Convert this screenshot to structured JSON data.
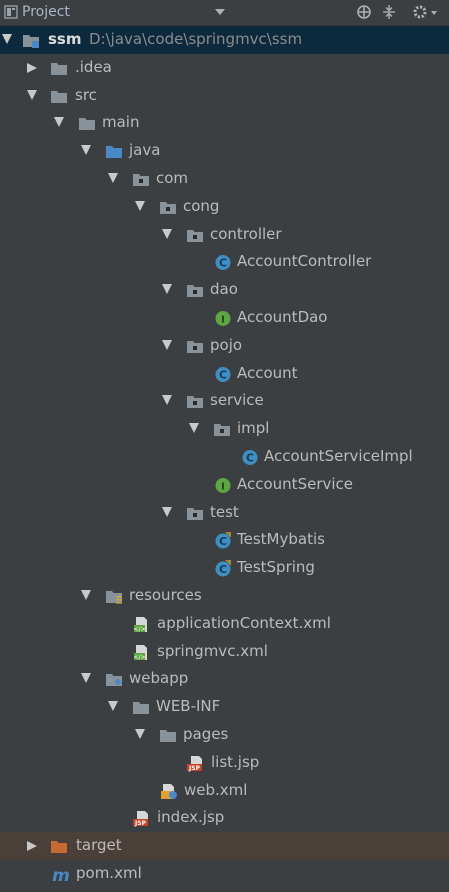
{
  "header": {
    "title": "Project"
  },
  "tree": [
    {
      "id": "ssm",
      "label": "ssm",
      "path": "D:\\java\\code\\springmvc\\ssm",
      "arrow": "down",
      "icon": "module-folder-icon",
      "bold": true,
      "selected": true
    },
    {
      "id": "idea",
      "label": ".idea",
      "arrow": "right",
      "icon": "folder-icon"
    },
    {
      "id": "src",
      "label": "src",
      "arrow": "down",
      "icon": "folder-icon"
    },
    {
      "id": "main",
      "label": "main",
      "arrow": "down",
      "icon": "folder-icon"
    },
    {
      "id": "java",
      "label": "java",
      "arrow": "down",
      "icon": "source-folder-icon"
    },
    {
      "id": "com",
      "label": "com",
      "arrow": "down",
      "icon": "package-icon"
    },
    {
      "id": "cong",
      "label": "cong",
      "arrow": "down",
      "icon": "package-icon"
    },
    {
      "id": "controller",
      "label": "controller",
      "arrow": "down",
      "icon": "package-icon"
    },
    {
      "id": "accountcontroller",
      "label": "AccountController",
      "icon": "class-icon"
    },
    {
      "id": "dao",
      "label": "dao",
      "arrow": "down",
      "icon": "package-icon"
    },
    {
      "id": "accountdao",
      "label": "AccountDao",
      "icon": "interface-icon"
    },
    {
      "id": "pojo",
      "label": "pojo",
      "arrow": "down",
      "icon": "package-icon"
    },
    {
      "id": "account",
      "label": "Account",
      "icon": "class-icon"
    },
    {
      "id": "service",
      "label": "service",
      "arrow": "down",
      "icon": "package-icon"
    },
    {
      "id": "impl",
      "label": "impl",
      "arrow": "down",
      "icon": "package-icon"
    },
    {
      "id": "accountserviceimpl",
      "label": "AccountServiceImpl",
      "icon": "class-icon"
    },
    {
      "id": "accountservice",
      "label": "AccountService",
      "icon": "interface-icon"
    },
    {
      "id": "test",
      "label": "test",
      "arrow": "down",
      "icon": "package-icon"
    },
    {
      "id": "testmybatis",
      "label": "TestMybatis",
      "icon": "test-class-icon"
    },
    {
      "id": "testspring",
      "label": "TestSpring",
      "icon": "test-class-icon"
    },
    {
      "id": "resources",
      "label": "resources",
      "arrow": "down",
      "icon": "resources-folder-icon"
    },
    {
      "id": "appctx",
      "label": "applicationContext.xml",
      "icon": "spring-xml-icon"
    },
    {
      "id": "springmvcxml",
      "label": "springmvc.xml",
      "icon": "spring-xml-icon"
    },
    {
      "id": "webapp",
      "label": "webapp",
      "arrow": "down",
      "icon": "web-folder-icon"
    },
    {
      "id": "webinf",
      "label": "WEB-INF",
      "arrow": "down",
      "icon": "folder-icon"
    },
    {
      "id": "pages",
      "label": "pages",
      "arrow": "down",
      "icon": "folder-icon"
    },
    {
      "id": "listjsp",
      "label": "list.jsp",
      "icon": "jsp-file-icon"
    },
    {
      "id": "webxml",
      "label": "web.xml",
      "icon": "web-xml-icon"
    },
    {
      "id": "indexjsp",
      "label": "index.jsp",
      "icon": "jsp-file-icon"
    },
    {
      "id": "target",
      "label": "target",
      "arrow": "right",
      "icon": "excluded-folder-icon",
      "hover": true
    },
    {
      "id": "pomxml",
      "label": "pom.xml",
      "icon": "maven-icon"
    }
  ]
}
